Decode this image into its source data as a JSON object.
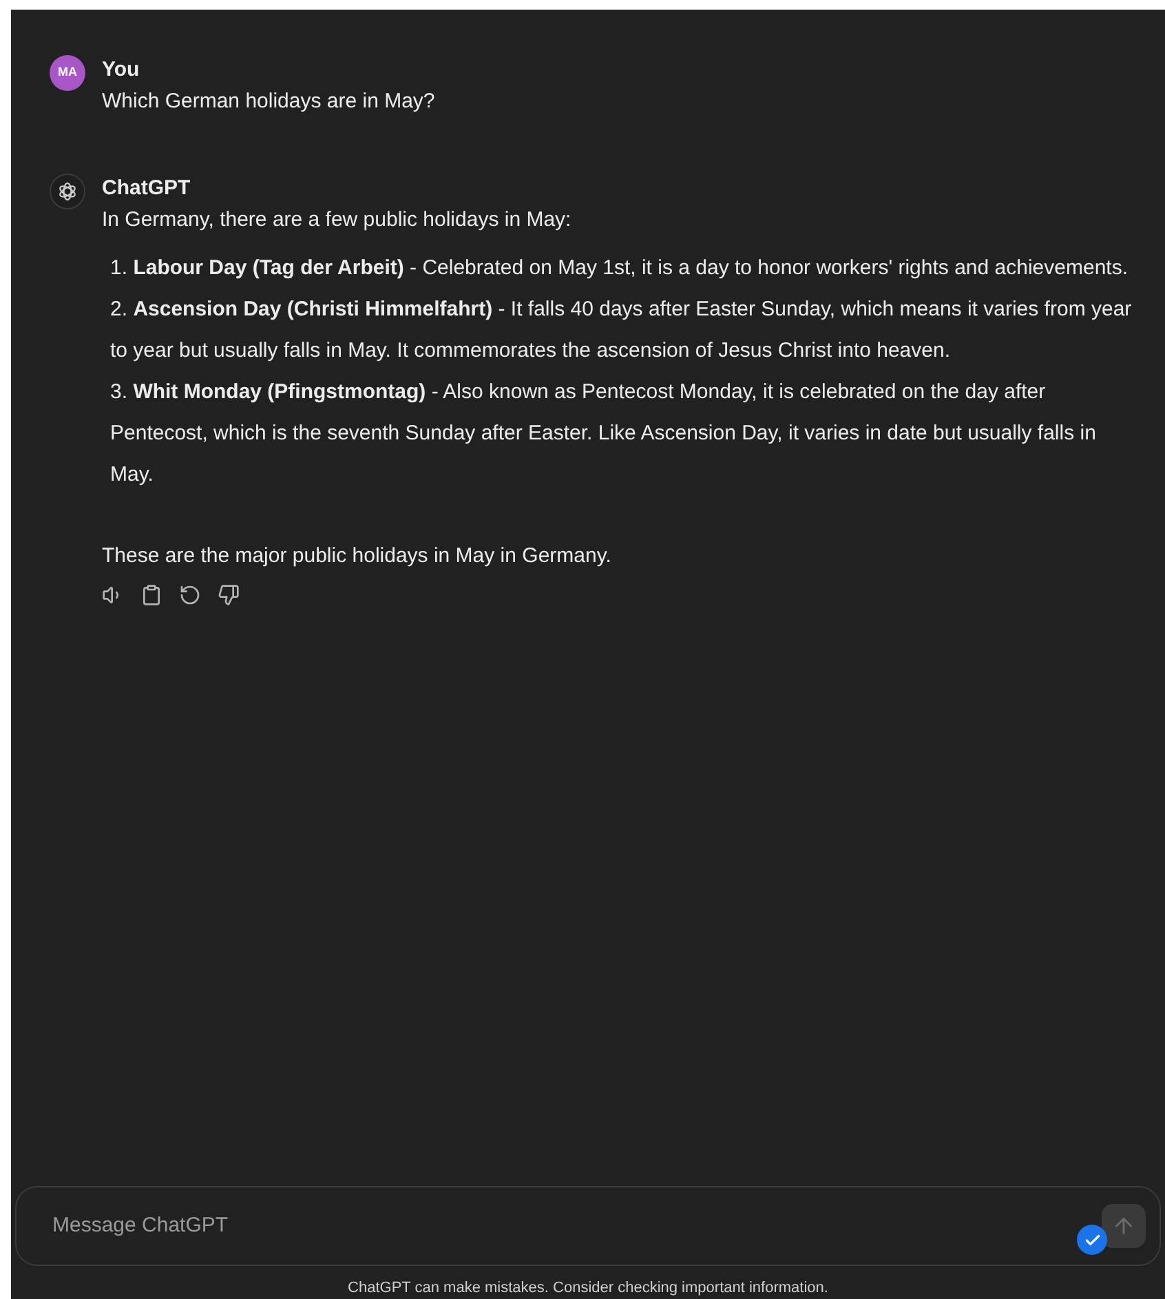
{
  "messages": [
    {
      "kind": "user",
      "avatar": "MA",
      "author": "You",
      "paragraphs": [
        "Which German holidays are in May?"
      ]
    },
    {
      "kind": "assistant",
      "author": "ChatGPT",
      "intro": "In Germany, there are a few public holidays in May:",
      "items": [
        "1. **Labour Day (Tag der Arbeit)** - Celebrated on May 1st, it is a day to honor workers' rights and achievements.",
        "2. **Ascension Day (Christi Himmelfahrt)** - It falls 40 days after Easter Sunday, which means it varies from year to year but usually falls in May. It commemorates the ascension of Jesus Christ into heaven.",
        "3. **Whit Monday (Pfingstmontag)** - Also known as Pentecost Monday, it is celebrated on the day after Pentecost, which is the seventh Sunday after Easter. Like Ascension Day, it varies in date but usually falls in May."
      ],
      "outro": "These are the major public holidays in May in Germany."
    }
  ],
  "composer": {
    "placeholder": "Message ChatGPT",
    "verified": true,
    "send_disabled": true
  },
  "footer": "ChatGPT can make mistakes. Consider checking important information."
}
